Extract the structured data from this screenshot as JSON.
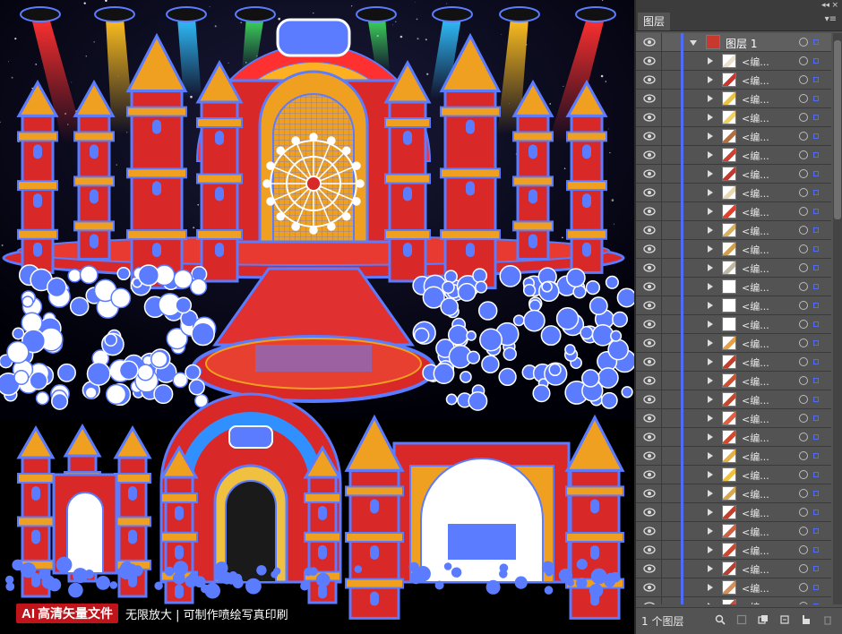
{
  "artwork": {
    "badge_ai": "AI",
    "badge_title": "高清矢量文件",
    "badge_desc": "无限放大 | 可制作喷绘写真印刷"
  },
  "panel": {
    "tab_label": "图层",
    "collapse_glyph": "◂◂",
    "close_glyph": "×",
    "menu_glyph": "▾≡",
    "top_layer_name": "图层 1",
    "sublayer_label": "<编...",
    "layer_count_text": "1 个图层",
    "sublayers": [
      {
        "thumb": "#e9e0d0"
      },
      {
        "thumb": "#c9382e"
      },
      {
        "thumb": "#e8c04a"
      },
      {
        "thumb": "#f0d060"
      },
      {
        "thumb": "#b07040"
      },
      {
        "thumb": "#d04030"
      },
      {
        "thumb": "#c03a30"
      },
      {
        "thumb": "#e8d8b0"
      },
      {
        "thumb": "#e04030"
      },
      {
        "thumb": "#d8b060"
      },
      {
        "thumb": "#d0a050"
      },
      {
        "thumb": "#c0b8a0"
      },
      {
        "thumb": "#ffffff"
      },
      {
        "thumb": "#ffffff"
      },
      {
        "thumb": "#ffffff"
      },
      {
        "thumb": "#e8a040"
      },
      {
        "thumb": "#c04030"
      },
      {
        "thumb": "#d05030"
      },
      {
        "thumb": "#c04a30"
      },
      {
        "thumb": "#e06040"
      },
      {
        "thumb": "#d04a30"
      },
      {
        "thumb": "#e8b040"
      },
      {
        "thumb": "#f0c040"
      },
      {
        "thumb": "#d8a850"
      },
      {
        "thumb": "#c04030"
      },
      {
        "thumb": "#d06040"
      },
      {
        "thumb": "#c84a30"
      },
      {
        "thumb": "#b84030"
      },
      {
        "thumb": "#d09060"
      },
      {
        "thumb": "#c05040"
      }
    ],
    "accent": "#4e6cf5"
  },
  "icons": {
    "visibility": "eye-icon",
    "expand": "triangle-icon",
    "target": "target-circle-icon",
    "search": "search-icon",
    "new_layer": "new-layer-icon",
    "delete": "trash-icon"
  }
}
